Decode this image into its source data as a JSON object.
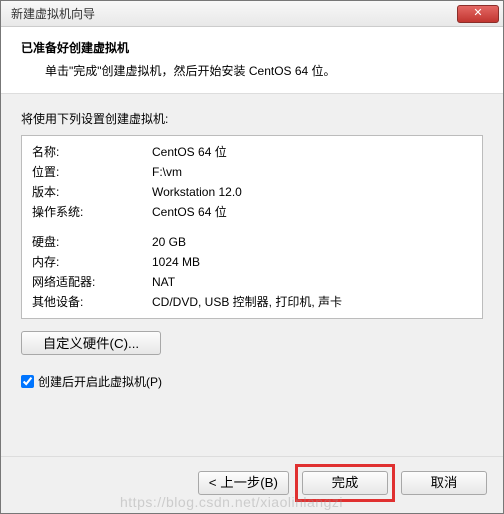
{
  "window": {
    "title": "新建虚拟机向导",
    "close": "✕"
  },
  "header": {
    "title": "已准备好创建虚拟机",
    "subtitle": "单击\"完成\"创建虚拟机，然后开始安装 CentOS 64 位。"
  },
  "body": {
    "settings_label": "将使用下列设置创建虚拟机:",
    "rows1": [
      {
        "label": "名称:",
        "value": "CentOS 64 位"
      },
      {
        "label": "位置:",
        "value": "F:\\vm"
      },
      {
        "label": "版本:",
        "value": "Workstation 12.0"
      },
      {
        "label": "操作系统:",
        "value": "CentOS 64 位"
      }
    ],
    "rows2": [
      {
        "label": "硬盘:",
        "value": "20 GB"
      },
      {
        "label": "内存:",
        "value": "1024 MB"
      },
      {
        "label": "网络适配器:",
        "value": "NAT"
      },
      {
        "label": "其他设备:",
        "value": "CD/DVD, USB 控制器, 打印机, 声卡"
      }
    ],
    "customize_btn": "自定义硬件(C)...",
    "checkbox_label": "创建后开启此虚拟机(P)",
    "checkbox_checked": true
  },
  "footer": {
    "back": "< 上一步(B)",
    "finish": "完成",
    "cancel": "取消"
  },
  "watermark": "https://blog.csdn.net/xiaolinlangzi"
}
